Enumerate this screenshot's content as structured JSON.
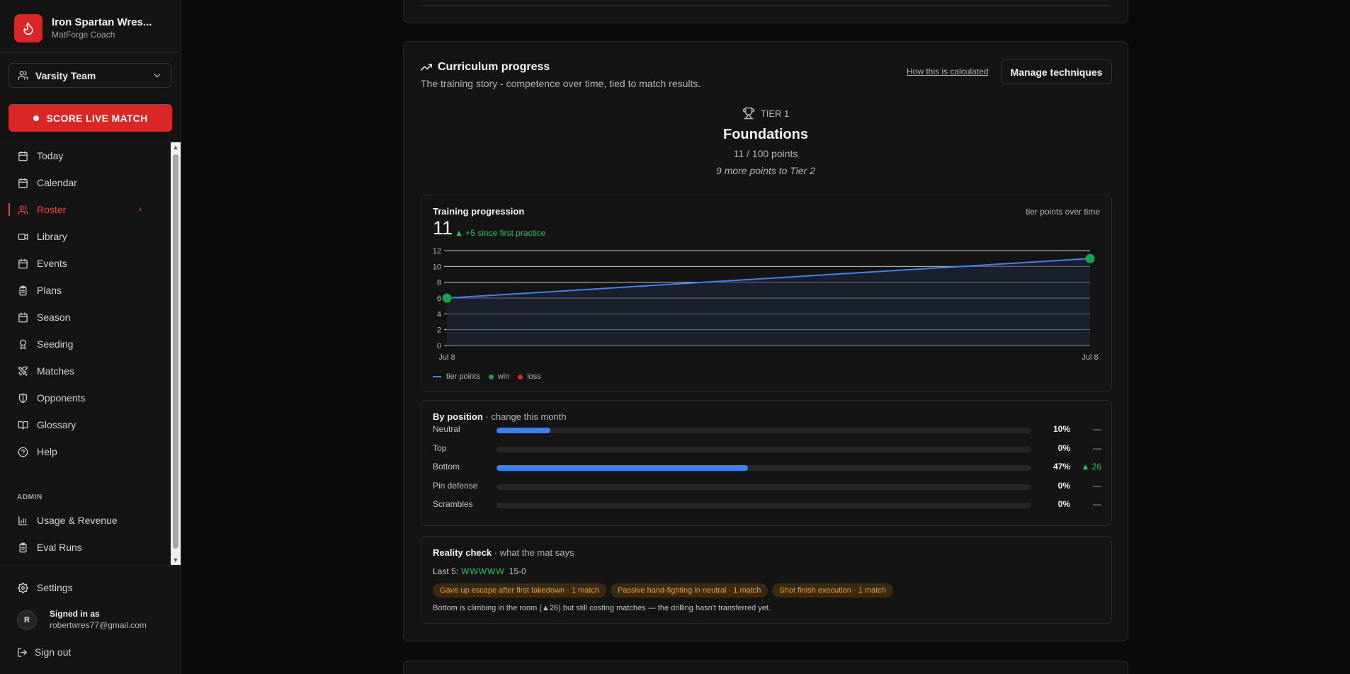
{
  "brand": {
    "name": "Iron Spartan Wres...",
    "subtitle": "MatForge Coach"
  },
  "team_select": {
    "label": "Varsity Team"
  },
  "score_button": {
    "label": "SCORE LIVE MATCH"
  },
  "nav": [
    {
      "label": "Today",
      "icon": "calendar-icon"
    },
    {
      "label": "Calendar",
      "icon": "calendar-icon"
    },
    {
      "label": "Roster",
      "icon": "users-icon",
      "active": true
    },
    {
      "label": "Library",
      "icon": "video-icon"
    },
    {
      "label": "Events",
      "icon": "calendar-icon"
    },
    {
      "label": "Plans",
      "icon": "clipboard-icon"
    },
    {
      "label": "Season",
      "icon": "calendar-icon"
    },
    {
      "label": "Seeding",
      "icon": "award-icon"
    },
    {
      "label": "Matches",
      "icon": "swords-icon"
    },
    {
      "label": "Opponents",
      "icon": "shield-icon"
    },
    {
      "label": "Glossary",
      "icon": "book-icon"
    },
    {
      "label": "Help",
      "icon": "help-circle-icon"
    }
  ],
  "admin": {
    "heading": "ADMIN",
    "items": [
      {
        "label": "Usage & Revenue",
        "icon": "bar-chart-icon"
      },
      {
        "label": "Eval Runs",
        "icon": "clipboard-icon"
      }
    ]
  },
  "settings": {
    "label": "Settings"
  },
  "user": {
    "initial": "R",
    "title": "Signed in as",
    "email": "robertwres77@gmail.com"
  },
  "signout": {
    "label": "Sign out"
  },
  "curriculum": {
    "title": "Curriculum progress",
    "subtitle": "The training story - competence over time, tied to match results.",
    "how_link": "How this is calculated",
    "manage_button": "Manage techniques",
    "tier": {
      "label": "TIER 1",
      "name": "Foundations",
      "points": "11 / 100 points",
      "more": "9 more points to Tier 2"
    }
  },
  "training": {
    "title": "Training progression",
    "caption": "tier points over time",
    "value": "11",
    "delta": "▲ +5 since first practice",
    "legend": {
      "line": "tier points",
      "win": "win",
      "loss": "loss"
    },
    "colors": {
      "line": "#3b82f6",
      "win": "#16a34a",
      "loss": "#dc2626"
    }
  },
  "chart_data": {
    "type": "line",
    "title": "Training progression",
    "x": [
      "Jul 8",
      "Jul 8"
    ],
    "series": [
      {
        "name": "tier points",
        "values": [
          6,
          11
        ],
        "markers": [
          "win",
          "win"
        ]
      }
    ],
    "yticks": [
      0,
      2,
      4,
      6,
      8,
      10,
      12
    ],
    "ylim": [
      0,
      12
    ],
    "xlabel": "",
    "ylabel": "",
    "grid": true,
    "legend": "bottom-left"
  },
  "positions": {
    "title": "By position",
    "subtitle": "· change this month",
    "rows": [
      {
        "name": "Neutral",
        "pct": "10%",
        "fraction": 0.1,
        "change": "—",
        "up": false
      },
      {
        "name": "Top",
        "pct": "0%",
        "fraction": 0,
        "change": "—",
        "up": false
      },
      {
        "name": "Bottom",
        "pct": "47%",
        "fraction": 0.47,
        "change": "▲ 26",
        "up": true
      },
      {
        "name": "Pin defense",
        "pct": "0%",
        "fraction": 0,
        "change": "—",
        "up": false
      },
      {
        "name": "Scrambles",
        "pct": "0%",
        "fraction": 0,
        "change": "—",
        "up": false
      }
    ]
  },
  "reality": {
    "title": "Reality check",
    "subtitle": "· what the mat says",
    "last5_label": "Last 5:",
    "last5_results": "WWWWW",
    "record": "15-0",
    "chips": [
      "Gave up escape after first takedown · 1 match",
      "Passive hand-fighting in neutral · 1 match",
      "Shot finish execution · 1 match"
    ],
    "note": "Bottom is climbing in the room (▲26) but still costing matches — the drilling hasn't transferred yet."
  }
}
